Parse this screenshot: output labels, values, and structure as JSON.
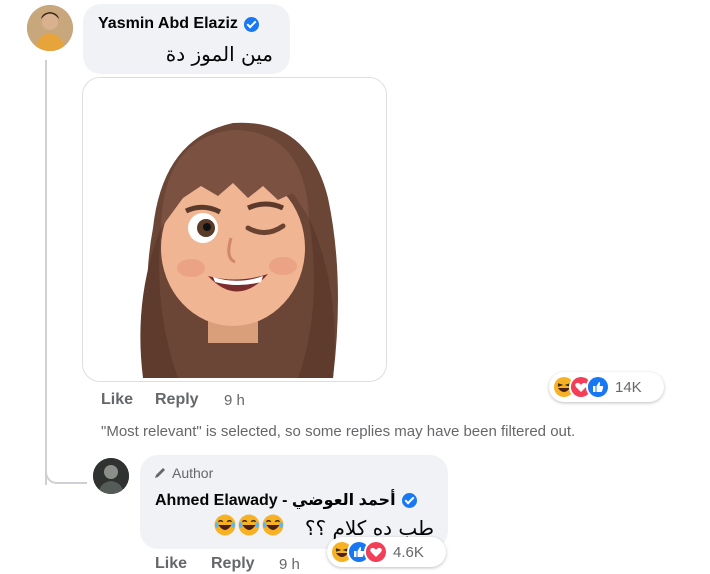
{
  "comment": {
    "author_name": "Yasmin Abd Elaziz",
    "text": "مين الموز دة",
    "actions": {
      "like": "Like",
      "reply": "Reply",
      "time": "9 h"
    },
    "reactions_count": "14K"
  },
  "filter_notice": "\"Most relevant\" is selected, so some replies may have been filtered out.",
  "reply": {
    "badge": "Author",
    "author_name": "Ahmed Elawady - أحمد العوضي",
    "text": "طب ده كلام ؟؟",
    "actions": {
      "like": "Like",
      "reply": "Reply",
      "time": "9 h"
    },
    "reactions_count": "4.6K"
  },
  "icons": {
    "verified": "verified-badge-icon",
    "author": "pencil-icon",
    "reactions": [
      "haha-icon",
      "love-icon",
      "like-icon"
    ]
  },
  "colors": {
    "like_blue": "#1877f2",
    "love_red": "#f33e58",
    "haha_yellow": "#f7b125",
    "muted": "#65676b",
    "bubble": "#f0f2f5"
  }
}
